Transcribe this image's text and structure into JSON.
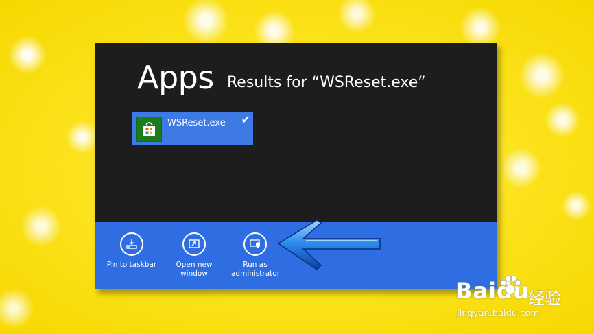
{
  "header": {
    "title": "Apps",
    "results_text": "Results for “WSReset.exe”"
  },
  "results": [
    {
      "label": "WSReset.exe",
      "selected": true,
      "icon": "store-bag-icon",
      "icon_color": "#1c7c1c"
    }
  ],
  "app_bar": {
    "color": "#2e6ee2",
    "commands": [
      {
        "label": "Pin to taskbar",
        "icon": "pin-taskbar-icon"
      },
      {
        "label": "Open new window",
        "icon": "open-new-window-icon"
      },
      {
        "label": "Run as administrator",
        "icon": "run-as-admin-shield-icon"
      }
    ]
  },
  "watermark": {
    "brand": "Baidu",
    "brand_cn": "经验",
    "url": "jingyan.baidu.com"
  },
  "colors": {
    "background": "#fbe21a",
    "window": "#1d1d1d",
    "tile": "#3d7ae6",
    "arrow": "#1e6fd6"
  }
}
